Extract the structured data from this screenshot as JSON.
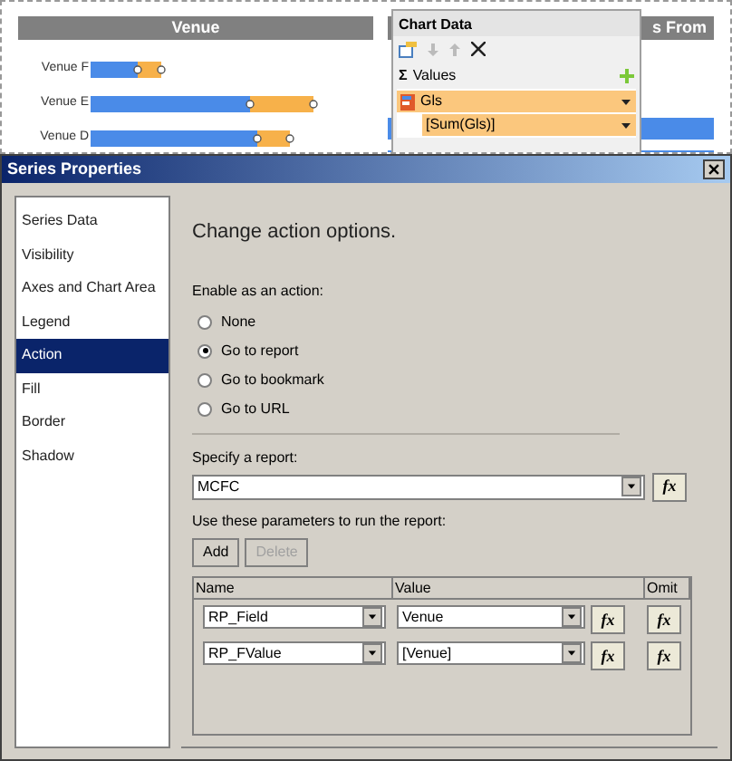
{
  "designer": {
    "chart": {
      "title": "Venue",
      "categories": [
        "Venue F",
        "Venue E",
        "Venue D"
      ]
    },
    "chart_2": {
      "title": "s From"
    },
    "chart_data_panel": {
      "title": "Chart Data",
      "values_icon": "Σ",
      "values_label": "Values",
      "fields": [
        {
          "label": "Gls",
          "kind": "series"
        },
        {
          "label": "[Sum(Gls)]",
          "kind": "expression"
        }
      ]
    }
  },
  "dialog": {
    "title": "Series Properties",
    "nav": [
      {
        "label": "Series Data",
        "selected": false
      },
      {
        "label": "Visibility",
        "selected": false
      },
      {
        "label": "Axes and Chart Area",
        "selected": false
      },
      {
        "label": "Legend",
        "selected": false
      },
      {
        "label": "Action",
        "selected": true
      },
      {
        "label": "Fill",
        "selected": false
      },
      {
        "label": "Border",
        "selected": false
      },
      {
        "label": "Shadow",
        "selected": false
      }
    ],
    "heading": "Change action options.",
    "action_label": "Enable as an action:",
    "actions": [
      {
        "label": "None",
        "selected": false
      },
      {
        "label": "Go to report",
        "selected": true
      },
      {
        "label": "Go to bookmark",
        "selected": false
      },
      {
        "label": "Go to URL",
        "selected": false
      }
    ],
    "report_label": "Specify a report:",
    "report": "MCFC",
    "report_fx": "fx",
    "params_label": "Use these parameters to run the report:",
    "buttons": [
      {
        "label": "Add",
        "disabled": false
      },
      {
        "label": "Delete",
        "disabled": true
      }
    ],
    "columns": [
      "Name",
      "Value",
      "Omit"
    ],
    "rows": [
      {
        "name": "RP_Field",
        "value": "Venue",
        "value_fx": "fx",
        "omit_fx": "fx"
      },
      {
        "name": "RP_FValue",
        "value": "[Venue]",
        "value_fx": "fx",
        "omit_fx": "fx"
      }
    ]
  }
}
